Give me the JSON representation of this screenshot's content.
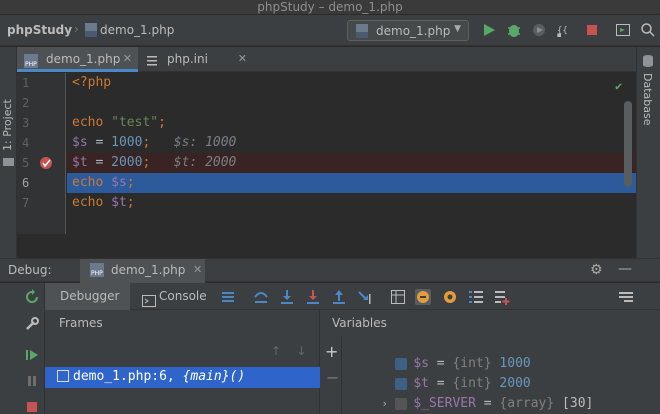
{
  "window": {
    "title": "phpStudy – demo_1.php"
  },
  "navbar": {
    "project": "phpStudy",
    "file": "demo_1.php",
    "run_config": "demo_1.php"
  },
  "left_stripe": {
    "project_label": "1: Project"
  },
  "right_stripe": {
    "database_label": "Database"
  },
  "tabs": [
    {
      "label": "demo_1.php",
      "active": true
    },
    {
      "label": "php.ini",
      "active": false
    }
  ],
  "editor": {
    "line_numbers": [
      "1",
      "2",
      "3",
      "4",
      "5",
      "6",
      "7"
    ],
    "current_line": "6",
    "breakpoint_line": "5",
    "lines": {
      "l1": {
        "open_tag": "<?php"
      },
      "l3": {
        "kw": "echo",
        "str": "\"test\"",
        "semi": ";"
      },
      "l4": {
        "var": "$s",
        "op": " = ",
        "num": "1000",
        "semi": ";",
        "inline": "$s: 1000"
      },
      "l5": {
        "var": "$t",
        "op": " = ",
        "num": "2000",
        "semi": ";",
        "inline": "$t: 2000"
      },
      "l6": {
        "kw": "echo",
        "var": "$s",
        "semi": ";"
      },
      "l7": {
        "kw": "echo",
        "var": "$t",
        "semi": ";"
      }
    }
  },
  "debug": {
    "label": "Debug:",
    "session_tab": "demo_1.php",
    "tabs": {
      "debugger": "Debugger",
      "console": "Console"
    },
    "frames": {
      "header": "Frames",
      "items": [
        {
          "file": "demo_1.php:6, ",
          "func": "{main}()"
        }
      ]
    },
    "variables": {
      "header": "Variables",
      "items": [
        {
          "name": "$s",
          "eq": " = ",
          "type": "{int}",
          "value": "1000"
        },
        {
          "name": "$t",
          "eq": " = ",
          "type": "{int}",
          "value": "2000"
        },
        {
          "name": "$_SERVER",
          "eq": " = ",
          "type": "{array}",
          "value": "[30]"
        }
      ]
    }
  },
  "colors": {
    "keyword": "#cc7832",
    "string": "#6a8759",
    "variable": "#9876aa",
    "number": "#6897bb",
    "selection": "#2f65ca",
    "exec_line": "#2d5a9a",
    "breakpoint": "#c75450",
    "run_green": "#59a869"
  },
  "icons": [
    "php-file-icon",
    "ini-file-icon",
    "run-icon",
    "debug-icon",
    "coverage-icon",
    "profile-icon",
    "stop-icon",
    "layout-icon",
    "search-icon",
    "checkmark-icon",
    "breakpoint-icon",
    "gear-icon",
    "minimize-icon",
    "rerun-icon",
    "wrench-icon",
    "resume-icon",
    "pause-icon",
    "stop-debug-icon",
    "show-execution-point-icon",
    "step-over-icon",
    "step-into-icon",
    "force-step-into-icon",
    "step-out-icon",
    "run-to-cursor-icon",
    "evaluate-icon",
    "watch-icon",
    "frame-up-icon",
    "frame-down-icon",
    "add-watch-icon",
    "remove-watch-icon",
    "expand-icon"
  ]
}
